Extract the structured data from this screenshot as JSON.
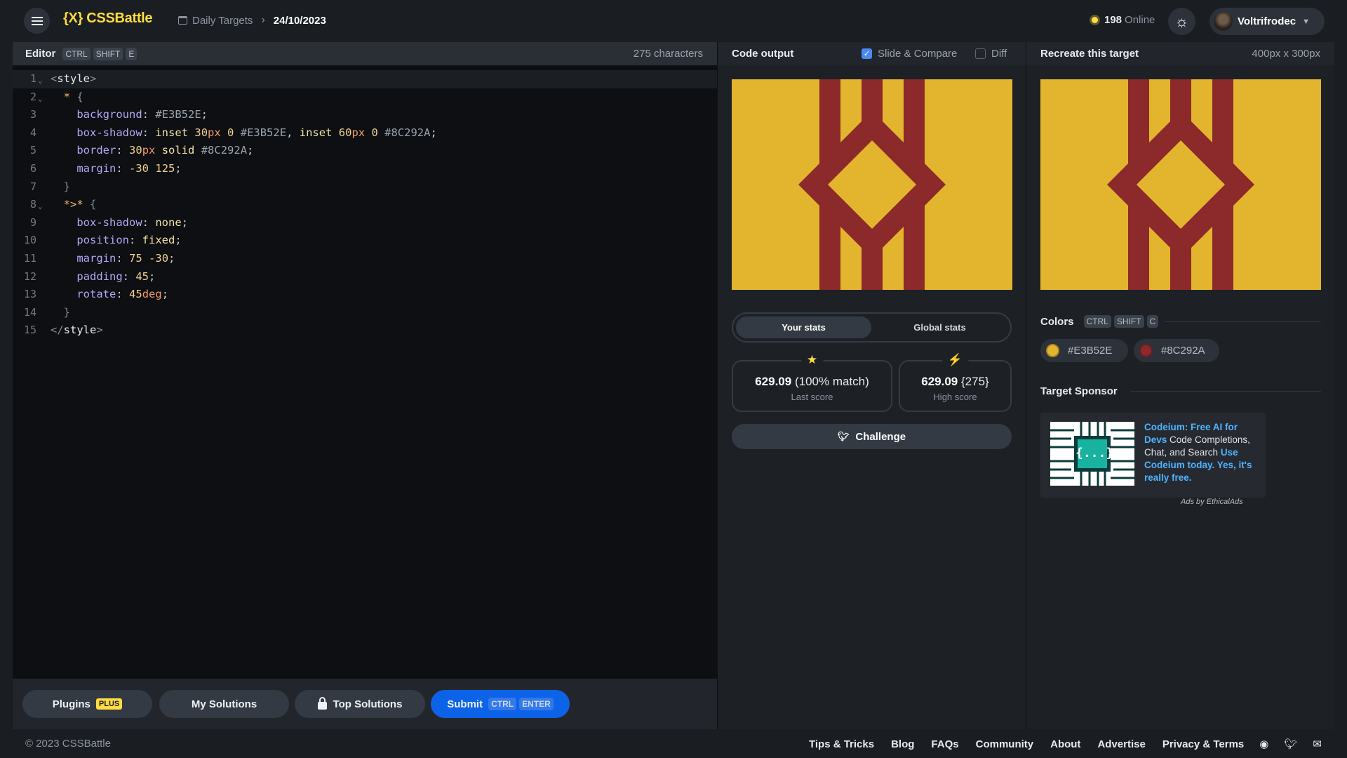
{
  "header": {
    "logo": "{X} CSSBattle",
    "breadcrumb_root": "Daily Targets",
    "breadcrumb_sep": "›",
    "breadcrumb_current": "24/10/2023",
    "online_count": "198",
    "online_label": "Online",
    "username": "Voltrifrodec",
    "icons": [
      "menu-icon",
      "calendar-icon",
      "sun-icon",
      "chevron-down-icon"
    ]
  },
  "editor": {
    "title": "Editor",
    "shortcut": [
      "CTRL",
      "SHIFT",
      "E"
    ],
    "char_count": "275 characters",
    "lines": [
      {
        "n": "1",
        "fold": "⌄",
        "html": "<span class='t-br'>&lt;</span><span class='t-tag'>style</span><span class='t-br'>&gt;</span>"
      },
      {
        "n": "2",
        "fold": "⌄",
        "html": "  <span class='t-sel'>*</span> <span class='t-br'>{</span>"
      },
      {
        "n": "3",
        "fold": "",
        "html": "    <span class='t-prop'>background</span><span class='t-punc'>:</span> <span class='t-hex'>#E3B52E</span><span class='t-punc'>;</span>"
      },
      {
        "n": "4",
        "fold": "",
        "html": "    <span class='t-prop'>box-shadow</span><span class='t-punc'>:</span> <span class='t-val'>inset</span> <span class='t-num'>30</span><span class='t-unit'>px</span> <span class='t-num'>0</span> <span class='t-hex'>#E3B52E</span><span class='t-punc'>,</span> <span class='t-val'>inset</span> <span class='t-num'>60</span><span class='t-unit'>px</span> <span class='t-num'>0</span> <span class='t-hex'>#8C292A</span><span class='t-punc'>;</span>"
      },
      {
        "n": "5",
        "fold": "",
        "html": "    <span class='t-prop'>border</span><span class='t-punc'>:</span> <span class='t-num'>30</span><span class='t-unit'>px</span> <span class='t-val'>solid</span> <span class='t-hex'>#8C292A</span><span class='t-punc'>;</span>"
      },
      {
        "n": "6",
        "fold": "",
        "html": "    <span class='t-prop'>margin</span><span class='t-punc'>:</span> <span class='t-num'>-30</span> <span class='t-num'>125</span><span class='t-punc'>;</span>"
      },
      {
        "n": "7",
        "fold": "",
        "html": "  <span class='t-br'>}</span>"
      },
      {
        "n": "8",
        "fold": "⌄",
        "html": "  <span class='t-sel'>*&gt;*</span> <span class='t-br'>{</span>"
      },
      {
        "n": "9",
        "fold": "",
        "html": "    <span class='t-prop'>box-shadow</span><span class='t-punc'>:</span> <span class='t-val'>none</span><span class='t-punc'>;</span>"
      },
      {
        "n": "10",
        "fold": "",
        "html": "    <span class='t-prop'>position</span><span class='t-punc'>:</span> <span class='t-val'>fixed</span><span class='t-punc'>;</span>"
      },
      {
        "n": "11",
        "fold": "",
        "html": "    <span class='t-prop'>margin</span><span class='t-punc'>:</span> <span class='t-num'>75</span> <span class='t-num'>-30</span><span class='t-punc'>;</span>"
      },
      {
        "n": "12",
        "fold": "",
        "html": "    <span class='t-prop'>padding</span><span class='t-punc'>:</span> <span class='t-num'>45</span><span class='t-punc'>;</span>"
      },
      {
        "n": "13",
        "fold": "",
        "html": "    <span class='t-prop'>rotate</span><span class='t-punc'>:</span> <span class='t-num'>45</span><span class='t-unit'>deg</span><span class='t-punc'>;</span>"
      },
      {
        "n": "14",
        "fold": "",
        "html": "  <span class='t-br'>}</span>"
      },
      {
        "n": "15",
        "fold": "",
        "html": "<span class='t-br'>&lt;/</span><span class='t-tag'>style</span><span class='t-br'>&gt;</span>"
      }
    ]
  },
  "editor_footer": {
    "plugins": "Plugins",
    "plugins_badge": "PLUS",
    "my_solutions": "My Solutions",
    "top_solutions": "Top Solutions",
    "submit": "Submit",
    "submit_keys": [
      "CTRL",
      "ENTER"
    ]
  },
  "output": {
    "title": "Code output",
    "slide_compare": "Slide & Compare",
    "slide_compare_checked": true,
    "diff": "Diff",
    "diff_checked": false,
    "tabs": [
      "Your stats",
      "Global stats"
    ],
    "active_tab": 0,
    "last_score": "629.09",
    "last_score_match": "(100% match)",
    "last_score_label": "Last score",
    "high_score": "629.09",
    "high_score_chars": "{275}",
    "high_score_label": "High score",
    "challenge": "Challenge"
  },
  "target": {
    "title": "Recreate this target",
    "dims": "400px x 300px",
    "colors_title": "Colors",
    "colors_keys": [
      "CTRL",
      "SHIFT",
      "C"
    ],
    "colors": [
      {
        "hex": "#E3B52E",
        "label": "#E3B52E"
      },
      {
        "hex": "#8C292A",
        "label": "#8C292A"
      }
    ],
    "sponsor_title": "Target Sponsor",
    "sponsor_logo_text": "{...}",
    "sponsor_head": "Codeium: Free AI for Devs",
    "sponsor_body": " Code Completions, Chat, and Search ",
    "sponsor_cta": "Use Codeium today. Yes, it's really free.",
    "ads_by": "Ads by EthicalAds"
  },
  "footer": {
    "copyright": "© 2023 CSSBattle",
    "links": [
      "Tips & Tricks",
      "Blog",
      "FAQs",
      "Community",
      "About",
      "Advertise",
      "Privacy & Terms"
    ],
    "icons": [
      "discord-icon",
      "twitter-icon",
      "mail-icon"
    ]
  },
  "canvas_colors": {
    "yellow": "#E3B52E",
    "red": "#8C292A"
  }
}
